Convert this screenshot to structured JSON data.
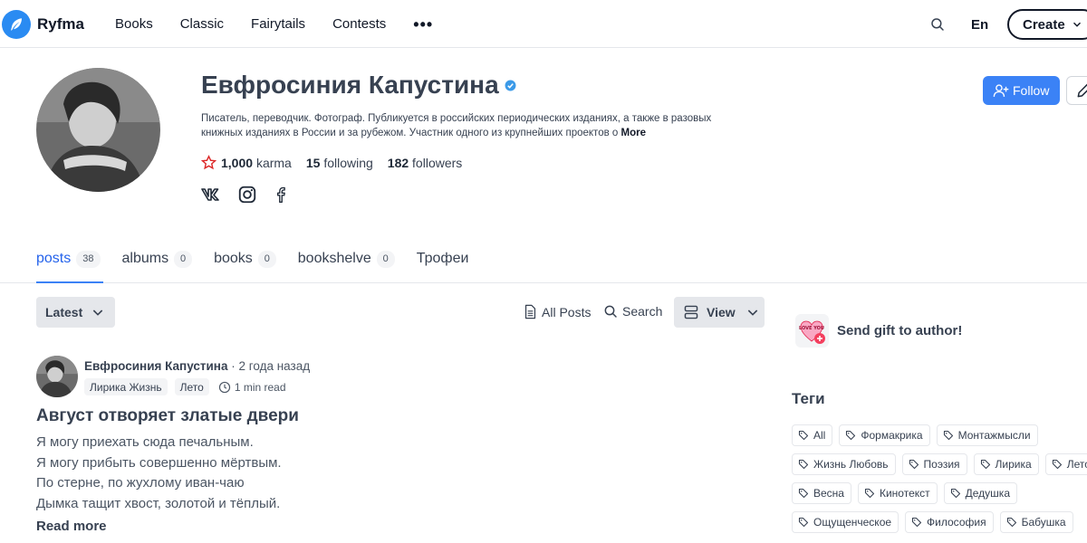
{
  "header": {
    "logo_text": "Ryfma",
    "nav": [
      "Books",
      "Classic",
      "Fairytails",
      "Contests"
    ],
    "more_label": "•••",
    "lang": "En",
    "create_label": "Create"
  },
  "profile": {
    "name": "Евфросиния Капустина",
    "bio": "Писатель, переводчик. Фотограф. Публикуется в российских периодических изданиях, а также в разовых книжных изданиях в России и за рубежом. Участник одного из крупнейших проектов о",
    "bio_more": "More",
    "karma_value": "1,000",
    "karma_label": "karma",
    "following_value": "15",
    "following_label": "following",
    "followers_value": "182",
    "followers_label": "followers",
    "follow_label": "Follow"
  },
  "tabs": [
    {
      "label": "posts",
      "count": "38"
    },
    {
      "label": "albums",
      "count": "0"
    },
    {
      "label": "books",
      "count": "0"
    },
    {
      "label": "bookshelve",
      "count": "0"
    },
    {
      "label": "Трофеи"
    }
  ],
  "toolbar": {
    "latest_label": "Latest",
    "all_posts_label": "All Posts",
    "search_label": "Search",
    "view_label": "View"
  },
  "post": {
    "author": "Евфросиния Капустина",
    "time": "· 2 года назад",
    "tags": [
      "Лирика Жизнь",
      "Лето"
    ],
    "read_time": "1 min read",
    "title": "Август отворяет златые двери",
    "lines": [
      "Я могу приехать сюда печальным.",
      "Я могу прибыть совершенно мёртвым.",
      "По стерне, по жухлому иван-чаю",
      "Дымка тащит хвост, золотой и тёплый."
    ],
    "read_more": "Read more"
  },
  "sidebar": {
    "gift_label": "Send gift to author!",
    "gift_icon_text": "LOVE YOU",
    "tags_title": "Теги",
    "tags_rows": [
      [
        "All",
        "Формакрика",
        "Монтажмысли"
      ],
      [
        "Жизнь Любовь",
        "Поэзия",
        "Лирика",
        "Лето"
      ],
      [
        "Весна",
        "Кинотекст",
        "Дедушка"
      ],
      [
        "Ощущенческое",
        "Философия",
        "Бабушка"
      ]
    ]
  },
  "colors": {
    "brand": "#2a8bf2",
    "follow": "#3b82f6",
    "active_tab": "#2563eb",
    "karma_star": "#dc2626"
  }
}
